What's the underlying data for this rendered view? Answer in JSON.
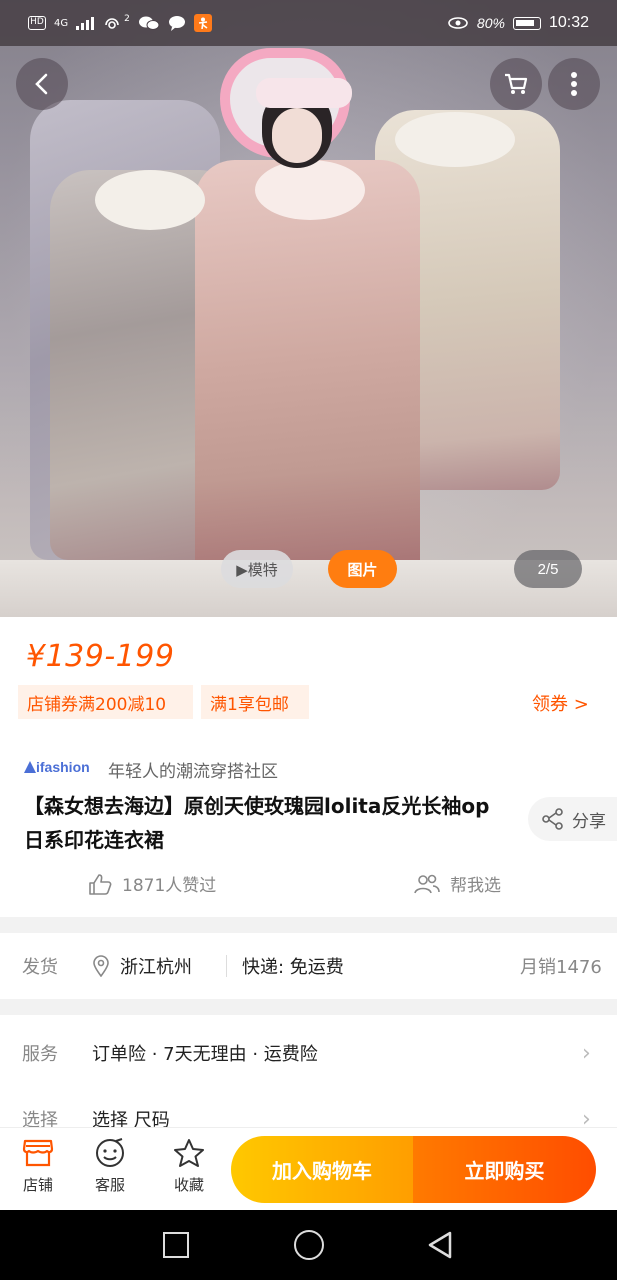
{
  "status_bar": {
    "hd": "HD",
    "network": "4G",
    "wifi_badge": "2",
    "battery": "80%",
    "time": "10:32"
  },
  "gallery": {
    "model_label": "▶模特",
    "picture_label": "图片",
    "counter": "2/5"
  },
  "product": {
    "price": "¥139-199",
    "coupons": [
      "店铺券满200减10",
      "满1享包邮"
    ],
    "get_coupon": "领券 >",
    "brand_logo": "ifashion",
    "brand_tagline": "年轻人的潮流穿搭社区",
    "title": "【森女想去海边】原创天使玫瑰园lolita反光长袖op日系印花连衣裙",
    "share_label": "分享",
    "likes": "1871人赞过",
    "help_pick": "帮我选"
  },
  "shipping": {
    "label": "发货",
    "location": "浙江杭州",
    "express": "快递: 免运费",
    "monthly_sales": "月销1476"
  },
  "service": {
    "label": "服务",
    "value": "订单险 · 7天无理由 · 运费险"
  },
  "select": {
    "label": "选择",
    "value": "选择 尺码"
  },
  "action_bar": {
    "store": "店铺",
    "customer_service": "客服",
    "favorite": "收藏",
    "add_to_cart": "加入购物车",
    "buy_now": "立即购买"
  },
  "colors": {
    "accent": "#ff5500",
    "cart_button": "#ffb000",
    "buy_button": "#ff5a00"
  }
}
